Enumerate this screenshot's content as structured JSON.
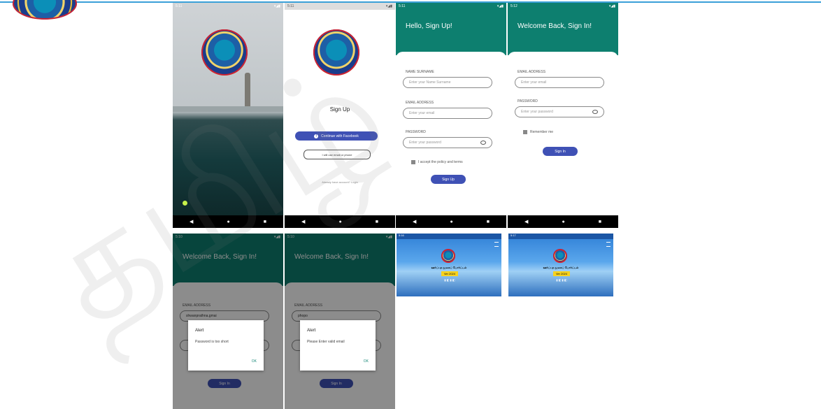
{
  "screen1": {
    "time": "5:11"
  },
  "screen2": {
    "time": "5:11",
    "title": "Sign Up",
    "facebook_button": "Continue with Facebook",
    "email_button": "I will use email or phone",
    "footer": "Already have account? Login"
  },
  "screen3": {
    "time": "5:11",
    "header": "Hello, Sign Up!",
    "name_label": "NAME SURNAME",
    "name_placeholder": "Enter your Name Surname",
    "email_label": "EMAIL ADDRESS",
    "email_placeholder": "Enter your email",
    "password_label": "PASSWORD",
    "password_placeholder": "Enter your password",
    "checkbox_label": "I accept the policy and terms",
    "signup_button": "Sign Up"
  },
  "screen4": {
    "time": "5:12",
    "header": "Welcome Back, Sign In!",
    "email_label": "EMAIL ADDRESS",
    "email_placeholder": "Enter your email",
    "password_label": "PASSWORD",
    "password_placeholder": "Enter your password",
    "remember_label": "Remember me",
    "signin_button": "Sign In"
  },
  "screen5": {
    "time": "5:10",
    "header": "Welcome Back, Sign In!",
    "email_label": "EMAIL ADDRESS",
    "email_value": "shwanprathna.gmai",
    "alert_title": "Alert",
    "alert_message": "Password is too short",
    "alert_ok": "OK",
    "signin_button": "Sign In"
  },
  "screen6": {
    "time": "5:10",
    "header": "Welcome Back, Sign In!",
    "email_label": "EMAIL ADDRESS",
    "email_value": "phopo",
    "alert_title": "Alert",
    "alert_message": "Please Enter valid email",
    "alert_ok": "OK",
    "signin_button": "Sign In"
  },
  "screen7": {
    "time": "5:16",
    "title": "ஊர்ப்புற நூலகப் போர்ட்டல்",
    "badge": "Ver 2024",
    "icons": "▮ ◧ ▮ ◧"
  },
  "screen8": {
    "time": "5:17",
    "title": "ஊர்ப்புற நூலகப் போர்ட்டல்",
    "badge": "Ver 2024",
    "icons": "▮ ◧ ▮ ◧"
  },
  "watermark": "தமிழ்",
  "colors": {
    "teal": "#0d7f6f",
    "indigo": "#3f51b5",
    "banner": "#2f7fd6"
  }
}
